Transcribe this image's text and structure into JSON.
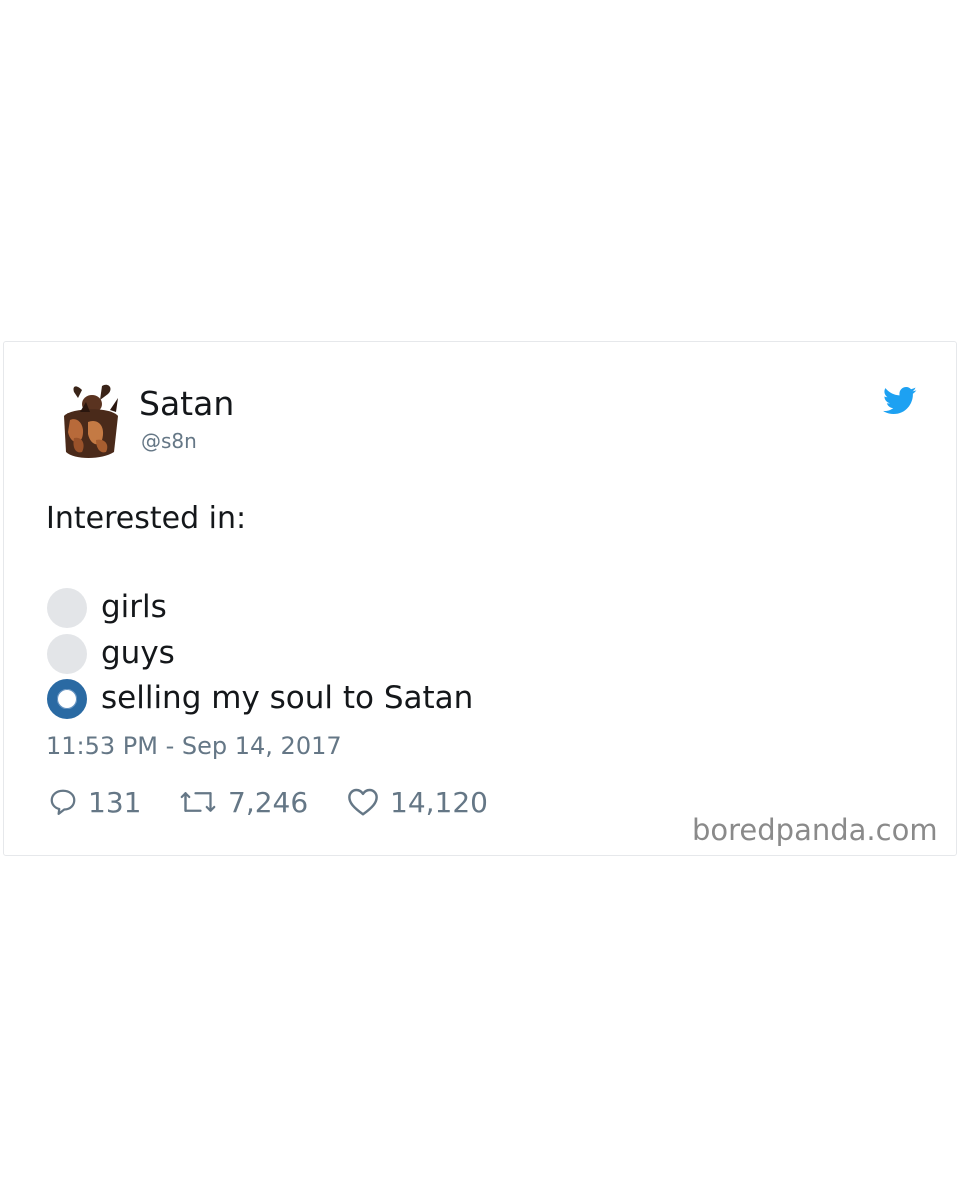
{
  "tweet": {
    "display_name": "Satan",
    "handle": "@s8n",
    "text": "Interested in:",
    "poll_options": [
      {
        "label": "girls",
        "selected": false
      },
      {
        "label": "guys",
        "selected": false
      },
      {
        "label": "selling my soul to Satan",
        "selected": true
      }
    ],
    "timestamp": "11:53 PM - Sep 14, 2017",
    "stats": {
      "replies": "131",
      "retweets": "7,246",
      "likes": "14,120"
    }
  },
  "icons": {
    "brand": "twitter-bird-icon",
    "reply": "reply-bubble-icon",
    "retweet": "retweet-icon",
    "like": "heart-icon"
  },
  "colors": {
    "twitter_blue": "#1da1f2",
    "selected_radio": "#2a6aa3",
    "muted_text": "#657786"
  },
  "watermark": "boredpanda.com"
}
